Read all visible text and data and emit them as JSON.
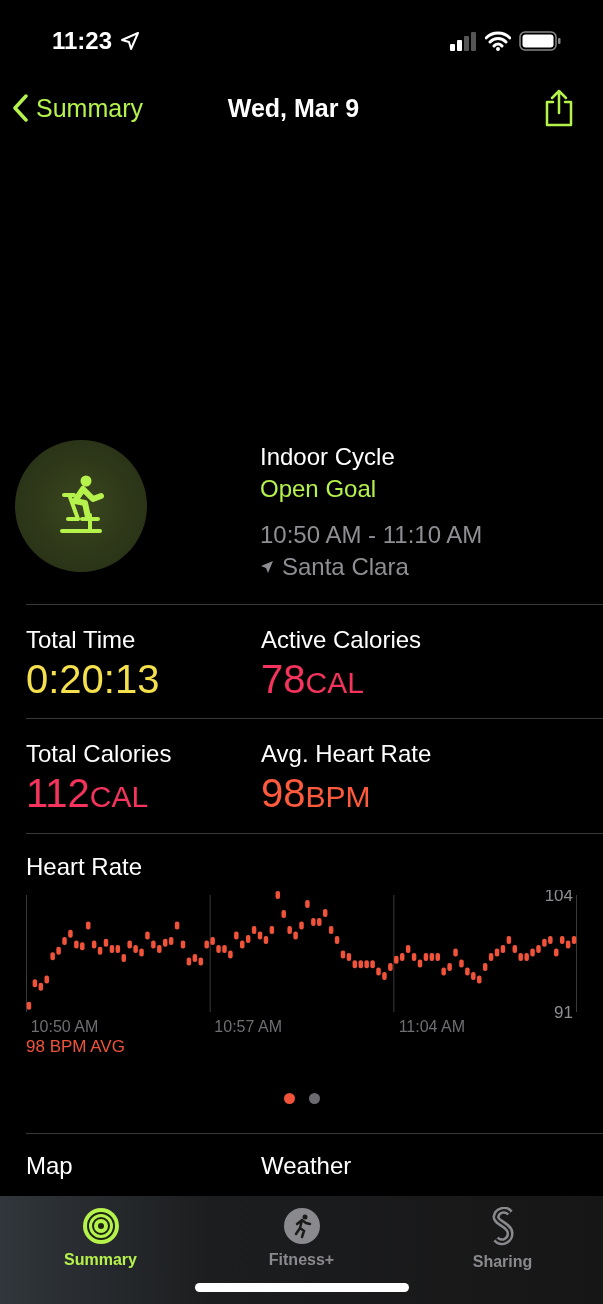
{
  "status_bar": {
    "time": "11:23"
  },
  "nav": {
    "back_label": "Summary",
    "title": "Wed, Mar 9"
  },
  "workout": {
    "name": "Indoor Cycle",
    "goal": "Open Goal",
    "time_range": "10:50 AM - 11:10 AM",
    "location": "Santa Clara"
  },
  "metrics": [
    {
      "label": "Total Time",
      "value": "0:20:13",
      "color": "#f4e04d"
    },
    {
      "label": "Active Calories",
      "value": "78",
      "unit": "CAL",
      "color": "#f5335c"
    },
    {
      "label": "Total Calories",
      "value": "112",
      "unit": "CAL",
      "color": "#f5335c"
    },
    {
      "label": "Avg. Heart Rate",
      "value": "98",
      "unit": "BPM",
      "color": "#ff5a3b"
    }
  ],
  "heart_rate": {
    "title": "Heart Rate",
    "average": "98 BPM AVG",
    "chart_data": {
      "type": "scatter",
      "ylim": [
        91,
        104
      ],
      "yticks": [
        91,
        104
      ],
      "categories": [
        null,
        null,
        null,
        null,
        null,
        null,
        "10:50 AM",
        null,
        null,
        null,
        null,
        null,
        null,
        null,
        null,
        null,
        null,
        null,
        null,
        null,
        null,
        null,
        null,
        null,
        null,
        null,
        null,
        null,
        null,
        null,
        null,
        null,
        null,
        null,
        null,
        null,
        null,
        "10:57 AM",
        null,
        null,
        null,
        null,
        null,
        null,
        null,
        null,
        null,
        null,
        null,
        null,
        null,
        null,
        null,
        null,
        null,
        null,
        null,
        null,
        null,
        null,
        null,
        null,
        null,
        null,
        null,
        null,
        null,
        null,
        "11:04 AM",
        null,
        null,
        null,
        null,
        null,
        null,
        null,
        null,
        null,
        null,
        null,
        null,
        null,
        null,
        null,
        null,
        null,
        null,
        null,
        null,
        null,
        null,
        null,
        null
      ],
      "series": [
        {
          "color": "#f0533a",
          "values": [
            91.7,
            94.2,
            93.8,
            94.6,
            97.2,
            97.8,
            98.9,
            99.7,
            98.5,
            98.3,
            100.6,
            98.5,
            97.8,
            98.7,
            98,
            98,
            97,
            98.5,
            98,
            97.6,
            99.5,
            98.5,
            98,
            98.7,
            98.9,
            100.6,
            98.5,
            96.6,
            97,
            96.6,
            98.5,
            98.9,
            98,
            98,
            97.4,
            99.5,
            98.5,
            99.1,
            100.1,
            99.5,
            99,
            100.1,
            104,
            101.9,
            100.1,
            99.5,
            100.6,
            103,
            101,
            101,
            102,
            100.1,
            99,
            97.4,
            97.1,
            96.3,
            96.3,
            96.3,
            96.3,
            95.5,
            95,
            96,
            96.8,
            97.1,
            98,
            97.1,
            96.4,
            97.1,
            97.1,
            97.1,
            95.5,
            96,
            97.6,
            96.4,
            95.5,
            95,
            94.6,
            96,
            97.1,
            97.6,
            98,
            99,
            98,
            97.1,
            97.1,
            97.6,
            98,
            98.7,
            99,
            97.6,
            99,
            98.5,
            99
          ]
        }
      ]
    }
  },
  "pages": [
    {
      "selected": true
    },
    {
      "selected": false
    }
  ],
  "sections": [
    "Map",
    "Weather"
  ],
  "tabs": [
    {
      "label": "Summary",
      "kind": "rings",
      "selected": true
    },
    {
      "label": "Fitness+",
      "kind": "runner",
      "selected": false
    },
    {
      "label": "Sharing",
      "kind": "sharing",
      "selected": false
    }
  ]
}
